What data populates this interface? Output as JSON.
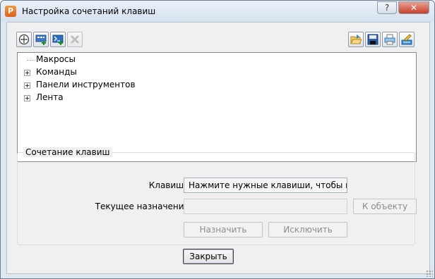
{
  "window": {
    "title": "Настройка сочетаний клавиш",
    "help_label": "?",
    "close_label": "✕"
  },
  "toolbar": {
    "left_icons": [
      "add-circle-icon",
      "add-shortcut-icon",
      "add-command-icon",
      "delete-icon"
    ],
    "right_icons": [
      "open-folder-icon",
      "save-icon",
      "print-icon",
      "edit-icon"
    ]
  },
  "tree": {
    "items": [
      {
        "label": "Макросы",
        "expandable": false
      },
      {
        "label": "Команды",
        "expandable": true
      },
      {
        "label": "Панели инструментов",
        "expandable": true
      },
      {
        "label": "Лента",
        "expandable": true
      }
    ]
  },
  "shortcut": {
    "group_title": "Сочетание клавиш",
    "keys_label": "Клавиши:",
    "keys_value": "Нажмите нужные клавиши, чтобы прове",
    "assignment_label": "Текущее назначение:",
    "assignment_value": "",
    "goto_button": "К объекту",
    "assign_button": "Назначить",
    "remove_button": "Исключить"
  },
  "footer": {
    "close_button": "Закрыть"
  }
}
